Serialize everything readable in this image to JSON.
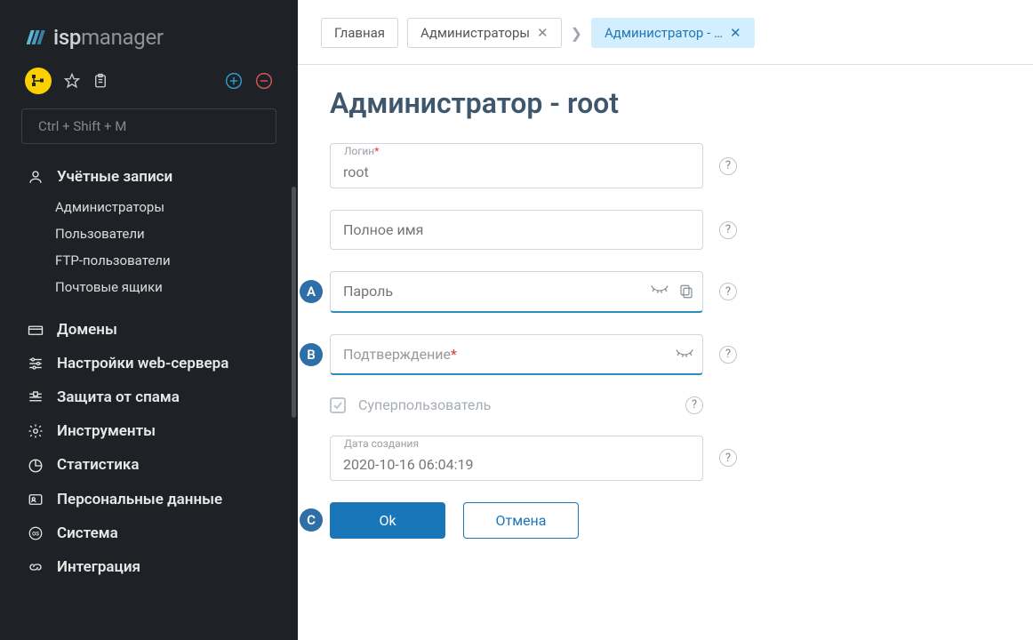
{
  "logo": {
    "bold": "isp",
    "light": "manager"
  },
  "toolbar": {
    "search_hint": "Ctrl + Shift + M"
  },
  "nav": {
    "accounts": {
      "label": "Учётные записи",
      "sub": [
        "Администраторы",
        "Пользователи",
        "FTP-пользователи",
        "Почтовые ящики"
      ]
    },
    "items": [
      "Домены",
      "Настройки web-сервера",
      "Защита от спама",
      "Инструменты",
      "Статистика",
      "Персональные данные",
      "Система",
      "Интеграция"
    ]
  },
  "breadcrumbs": {
    "home": "Главная",
    "admins": "Администраторы",
    "current": "Администратор - …"
  },
  "form": {
    "title": "Администратор - root",
    "login_label": "Логин",
    "login_value": "root",
    "fullname_ph": "Полное имя",
    "password_ph": "Пароль",
    "confirm_ph": "Подтверждение",
    "superuser_label": "Суперпользователь",
    "created_label": "Дата создания",
    "created_value": "2020-10-16 06:04:19",
    "ok": "Ok",
    "cancel": "Отмена"
  },
  "bullets": {
    "a": "A",
    "b": "B",
    "c": "C"
  }
}
